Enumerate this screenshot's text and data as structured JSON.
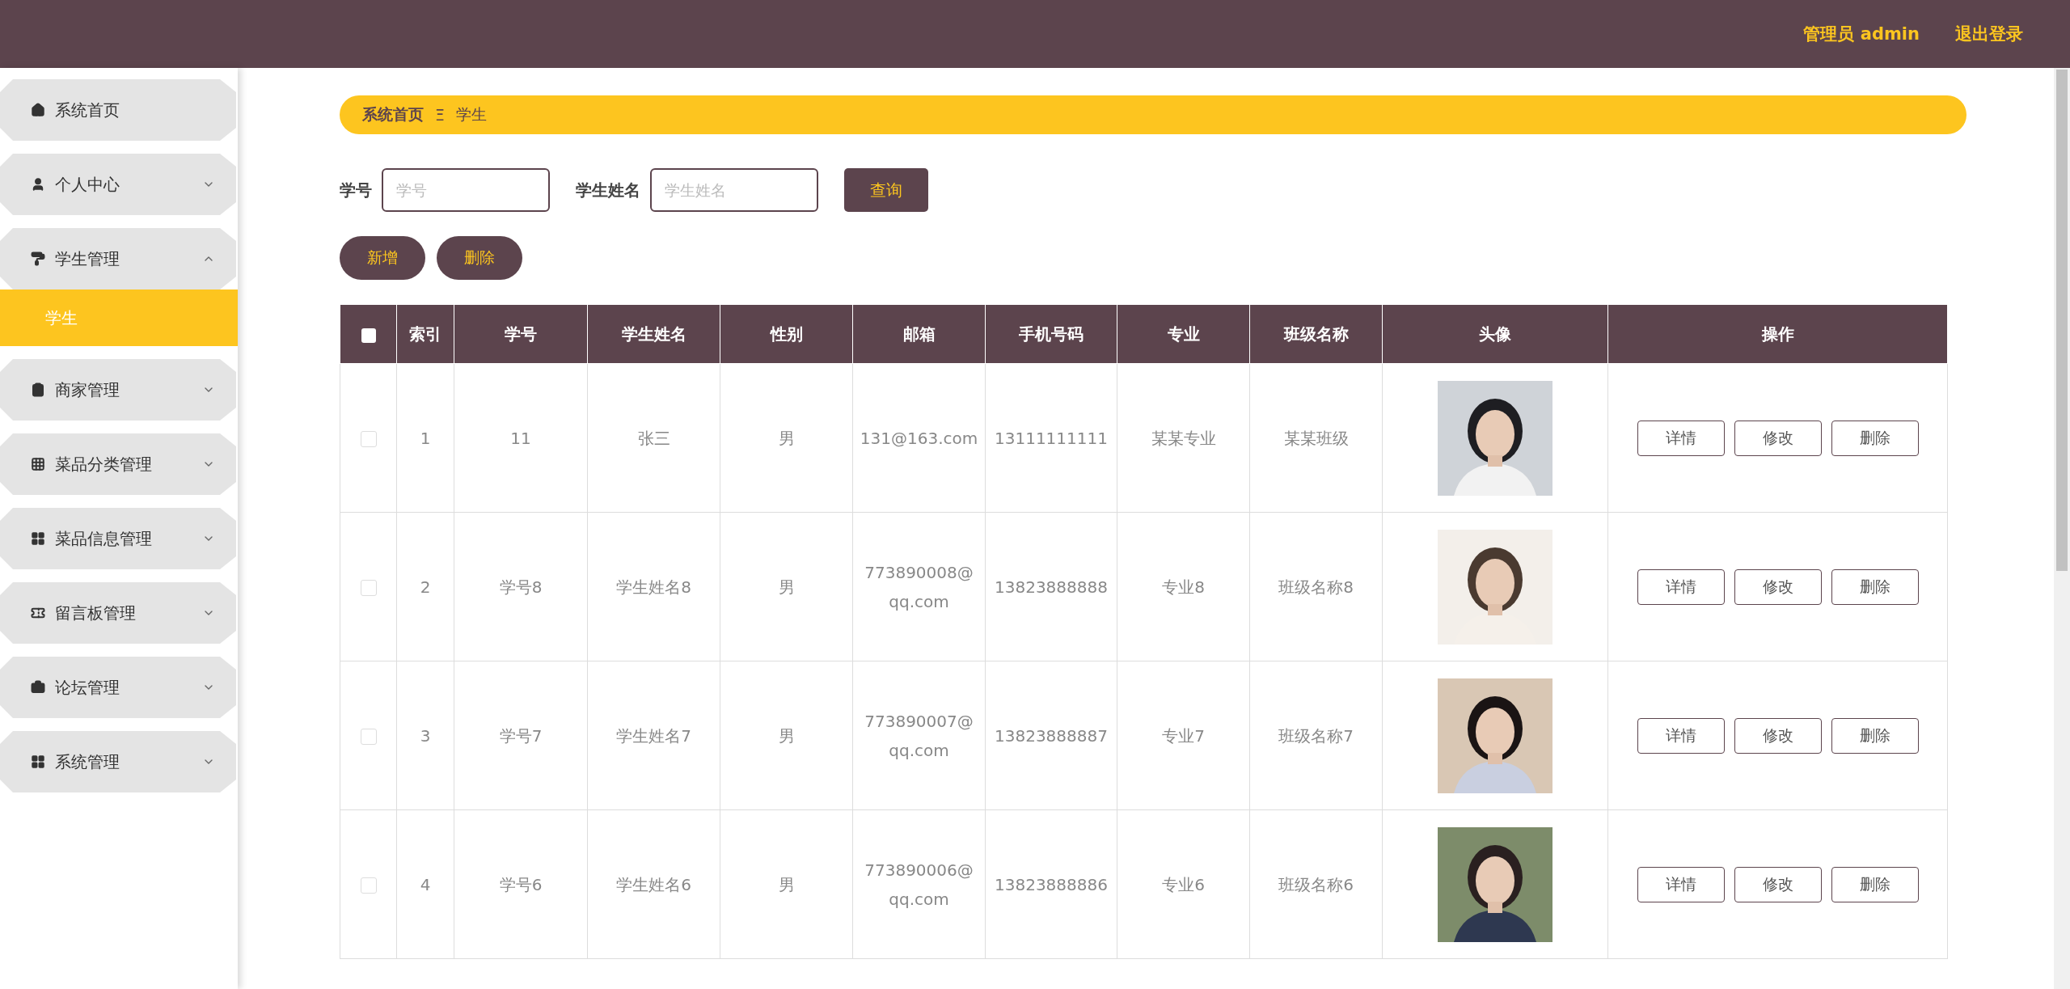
{
  "header": {
    "user": "管理员 admin",
    "logout": "退出登录"
  },
  "sidebar": {
    "items": [
      {
        "label": "系统首页",
        "expandable": false
      },
      {
        "label": "个人中心",
        "expandable": true,
        "expanded": false
      },
      {
        "label": "学生管理",
        "expandable": true,
        "expanded": true,
        "children": [
          {
            "label": "学生",
            "selected": true
          }
        ]
      },
      {
        "label": "商家管理",
        "expandable": true,
        "expanded": false
      },
      {
        "label": "菜品分类管理",
        "expandable": true,
        "expanded": false
      },
      {
        "label": "菜品信息管理",
        "expandable": true,
        "expanded": false
      },
      {
        "label": "留言板管理",
        "expandable": true,
        "expanded": false
      },
      {
        "label": "论坛管理",
        "expandable": true,
        "expanded": false
      },
      {
        "label": "系统管理",
        "expandable": true,
        "expanded": false
      }
    ]
  },
  "breadcrumb": {
    "home": "系统首页",
    "separator": "Ξ",
    "current": "学生"
  },
  "search": {
    "fields": [
      {
        "label": "学号",
        "placeholder": "学号"
      },
      {
        "label": "学生姓名",
        "placeholder": "学生姓名"
      }
    ],
    "button": "查询"
  },
  "actions": [
    "新增",
    "删除"
  ],
  "table": {
    "header_checked": false,
    "columns": [
      "索引",
      "学号",
      "学生姓名",
      "性别",
      "邮箱",
      "手机号码",
      "专业",
      "班级名称",
      "头像",
      "操作"
    ],
    "rows": [
      {
        "checked": false,
        "cells": [
          "1",
          "11",
          "张三",
          "男",
          "131@163.com",
          "13111111111",
          "某某专业",
          "某某班级"
        ],
        "buttons": [
          "详情",
          "修改",
          "删除"
        ]
      },
      {
        "checked": false,
        "cells": [
          "2",
          "学号8",
          "学生姓名8",
          "男",
          "773890008@qq.com",
          "13823888888",
          "专业8",
          "班级名称8"
        ],
        "buttons": [
          "详情",
          "修改",
          "删除"
        ]
      },
      {
        "checked": false,
        "cells": [
          "3",
          "学号7",
          "学生姓名7",
          "男",
          "773890007@qq.com",
          "13823888887",
          "专业7",
          "班级名称7"
        ],
        "buttons": [
          "详情",
          "修改",
          "删除"
        ]
      },
      {
        "checked": false,
        "cells": [
          "4",
          "学号6",
          "学生姓名6",
          "男",
          "773890006@qq.com",
          "13823888886",
          "专业6",
          "班级名称6"
        ],
        "buttons": [
          "详情",
          "修改",
          "删除"
        ]
      }
    ]
  }
}
